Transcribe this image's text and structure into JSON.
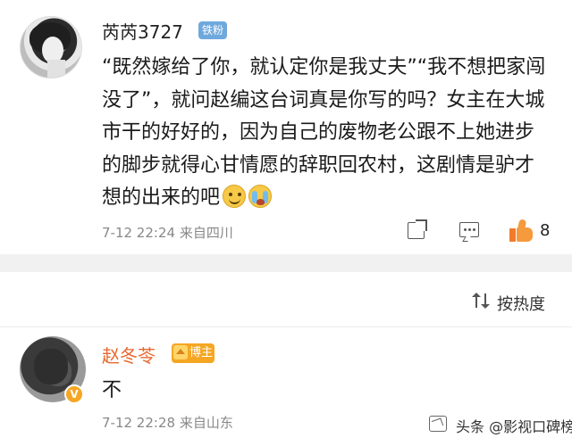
{
  "post": {
    "username": "芮芮3727",
    "badge": "铁粉",
    "text": "“既然嫁给了你，就认定你是我丈夫”“我不想把家闯没了”，就问赵编这台词真是你写的吗？女主在大城市干的好好的，因为自己的废物老公跟不上她进步的脚步就得心甘情愿的辞职回农村，这剧情是驴才想的出来的吧",
    "emojis": [
      "smile-emoji",
      "crying-emoji"
    ],
    "timestamp": "7-12 22:24",
    "source": "来自四川",
    "like_count": "8",
    "like_color": "#f27a2a"
  },
  "sort": {
    "label": "按热度"
  },
  "reply": {
    "username": "赵冬苓",
    "badge": "博主",
    "verified_mark": "V",
    "text": "不",
    "timestamp": "7-12 22:28",
    "source": "来自山东",
    "name_color": "#e9672c"
  },
  "watermark": {
    "text": "头条 @影视口碑榜"
  }
}
